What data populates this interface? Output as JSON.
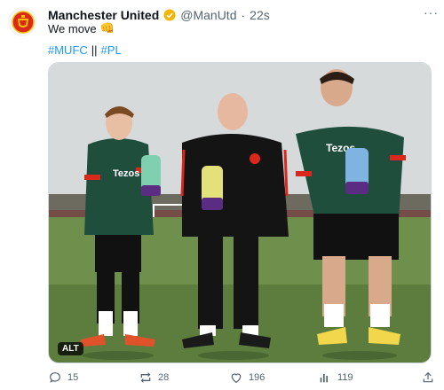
{
  "tweet": {
    "author_name": "Manchester United",
    "handle": "@ManUtd",
    "time": "22s",
    "text": "We move",
    "emoji": "👊",
    "hashtags": [
      "#MUFC",
      "#PL"
    ],
    "hashtag_separator": "||",
    "alt_label": "ALT",
    "more_glyph": "···"
  },
  "photo": {
    "sponsor_text": "Tezos",
    "scene": "Three men in red and green training kit holding Premier League award bottles on a grass training pitch"
  },
  "actions": {
    "replies": "15",
    "reposts": "28",
    "likes": "196",
    "views": "119"
  },
  "colors": {
    "accent": "#1d9bf0",
    "verified": "#f4b400",
    "text_secondary": "#536471",
    "club_red": "#da291c",
    "kit_green": "#1f4e3d"
  }
}
